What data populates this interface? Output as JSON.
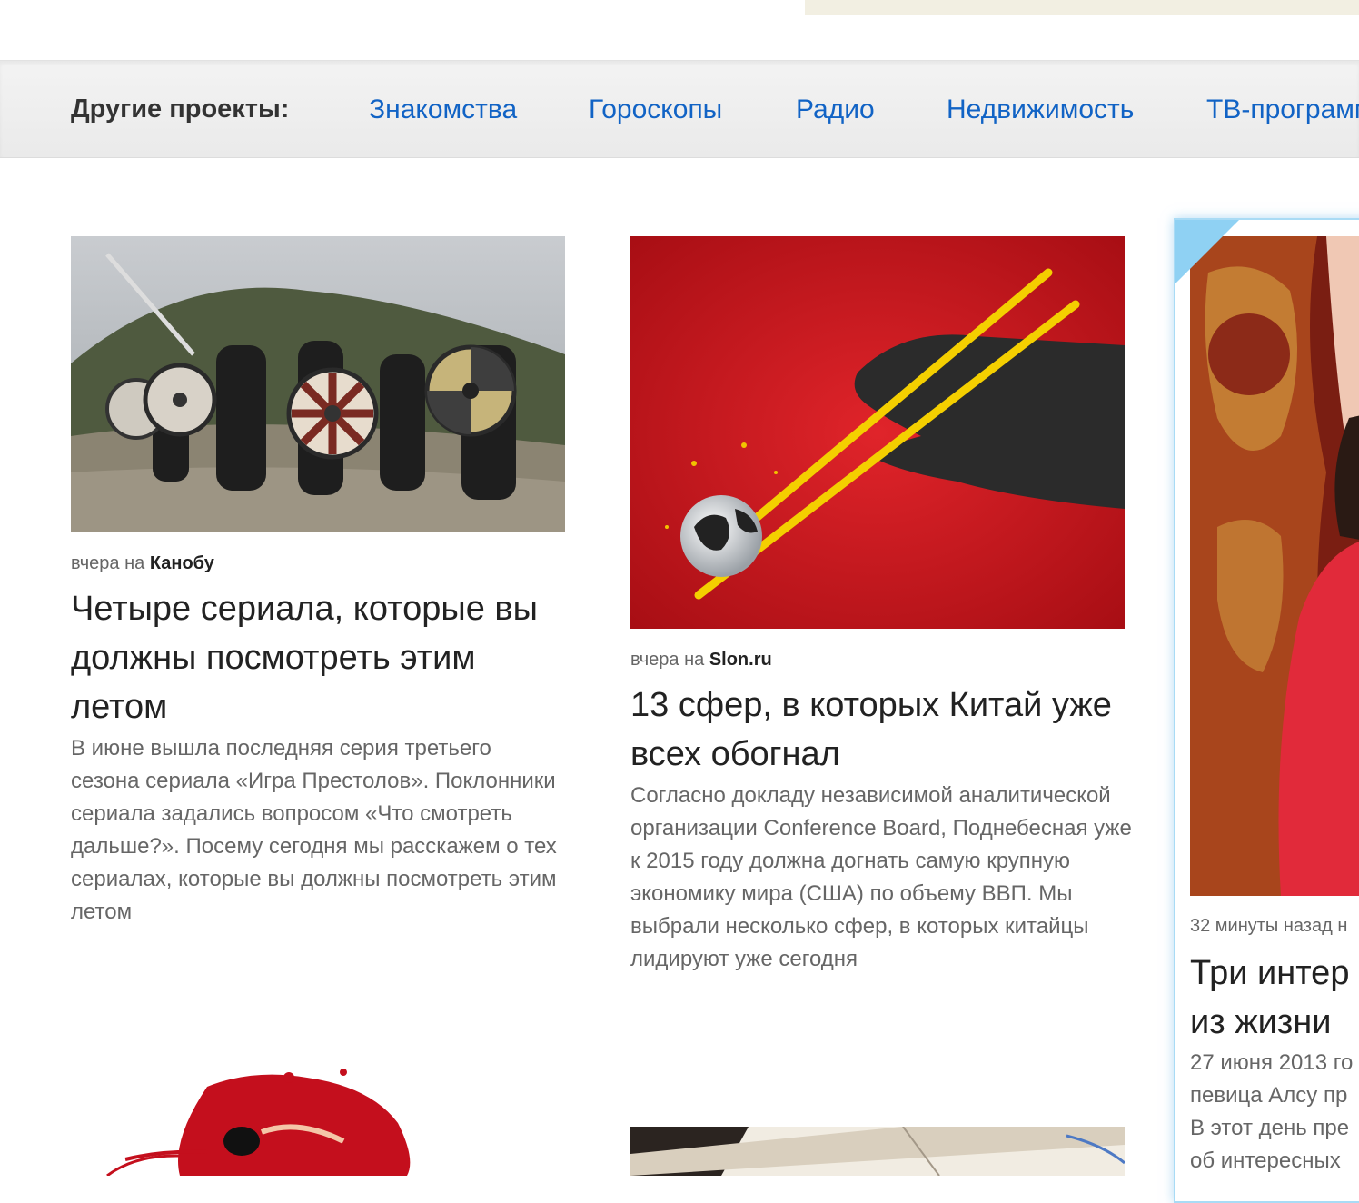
{
  "projects_bar": {
    "label": "Другие проекты:",
    "links": [
      "Знакомства",
      "Гороскопы",
      "Радио",
      "Недвижимость",
      "ТВ-программ"
    ]
  },
  "articles": [
    {
      "when": "вчера на",
      "source": "Канобу",
      "title": "Четыре сериала, которые вы должны посмотреть этим летом",
      "lead": "В июне вышла последняя серия третьего сезона сериала «Игра Престолов». Поклонники сериала задались вопросом «Что смотреть дальше?». Посему сегодня мы расскажем о тех сериалах, которые вы должны посмотреть этим летом"
    },
    {
      "when": "вчера на",
      "source": "Slon.ru",
      "title": "13 сфер, в которых Китай уже всех обогнал",
      "lead": "Согласно докладу независимой аналитической организации Conference Board, Поднебесная уже к 2015 году должна догнать самую крупную экономику мира (США) по объему ВВП. Мы выбрали несколько сфер, в которых китайцы лидируют уже сегодня"
    },
    {
      "when": "32 минуты назад н",
      "title_line1": "Три интер",
      "title_line2": "из жизни",
      "lead_lines": [
        "27 июня 2013 го",
        "певица Алсу пр",
        "В этот день пре",
        "об интересных"
      ]
    }
  ]
}
